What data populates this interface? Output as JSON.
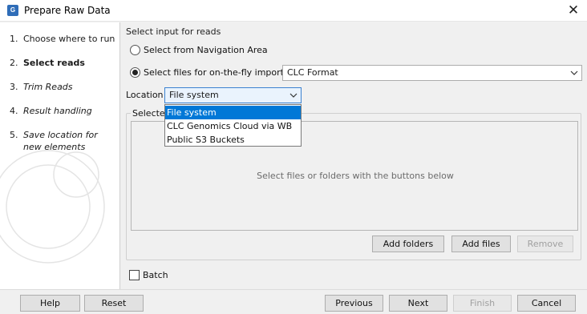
{
  "window": {
    "title": "Prepare Raw Data",
    "close_label": "✕"
  },
  "steps": [
    {
      "num": "1.",
      "label": "Choose where to run"
    },
    {
      "num": "2.",
      "label": "Select reads"
    },
    {
      "num": "3.",
      "label": "Trim Reads"
    },
    {
      "num": "4.",
      "label": "Result handling"
    },
    {
      "num": "5.",
      "label": "Save location for new elements"
    }
  ],
  "main": {
    "section_title": "Select input for reads",
    "radio_nav_label": "Select from Navigation Area",
    "radio_files_label": "Select files for on-the-fly import:",
    "import_format": "CLC Format",
    "location_label": "Location",
    "location_value": "File system",
    "group_title": "Selected",
    "placeholder": "Select files or folders with the buttons below",
    "add_folders": "Add folders",
    "add_files": "Add files",
    "remove": "Remove",
    "batch_label": "Batch"
  },
  "dropdown": {
    "options": [
      "File system",
      "CLC Genomics Cloud via WB",
      "Public S3 Buckets"
    ]
  },
  "footer": {
    "help": "Help",
    "reset": "Reset",
    "previous": "Previous",
    "next": "Next",
    "finish": "Finish",
    "cancel": "Cancel"
  }
}
